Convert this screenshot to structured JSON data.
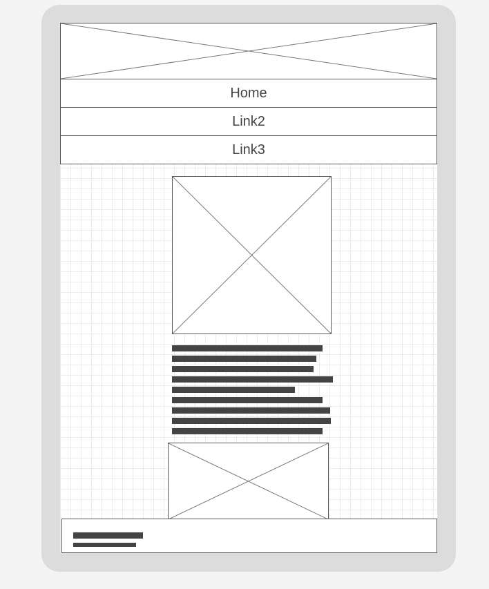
{
  "nav": {
    "links": [
      {
        "label": "Home"
      },
      {
        "label": "Link2"
      },
      {
        "label": "Link3"
      }
    ]
  },
  "colors": {
    "frame": "#dcdcdc",
    "background": "#f4f4f4",
    "grid": "#ececec",
    "outline": "#555555",
    "text_placeholder": "#444444",
    "nav_text": "#444444"
  },
  "icons": {
    "image_placeholder": "image-placeholder-icon"
  }
}
